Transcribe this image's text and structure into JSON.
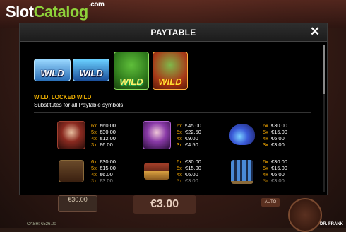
{
  "logo": {
    "part1": "Slot",
    "part2": "Catalog",
    "suffix": ".com"
  },
  "modal": {
    "title": "PAYTABLE",
    "close_glyph": "✕"
  },
  "wild_symbols": [
    {
      "label": "WILD",
      "icon": "wild-ice-icon"
    },
    {
      "label": "WILD",
      "icon": "wild-lightning-icon"
    },
    {
      "label": "WILD",
      "icon": "frankenstein-wild-icon"
    },
    {
      "label": "WILD",
      "icon": "locked-frankenstein-wild-icon"
    }
  ],
  "wild_info": {
    "heading": "WILD, LOCKED WILD",
    "description": "Substitutes for all Paytable symbols."
  },
  "paytable": [
    {
      "icon": "doctor-icon",
      "pays": [
        [
          "6x",
          "€60.00"
        ],
        [
          "5x",
          "€30.00"
        ],
        [
          "4x",
          "€12.00"
        ],
        [
          "3x",
          "€6.00"
        ]
      ]
    },
    {
      "icon": "bride-icon",
      "pays": [
        [
          "6x",
          "€45.00"
        ],
        [
          "5x",
          "€22.50"
        ],
        [
          "4x",
          "€9.00"
        ],
        [
          "3x",
          "€4.50"
        ]
      ]
    },
    {
      "icon": "potion-flask-icon",
      "pays": [
        [
          "6x",
          "€30.00"
        ],
        [
          "5x",
          "€15.00"
        ],
        [
          "4x",
          "€6.00"
        ],
        [
          "3x",
          "€3.00"
        ]
      ]
    },
    {
      "icon": "machine-box-icon",
      "pays": [
        [
          "6x",
          "€30.00"
        ],
        [
          "5x",
          "€15.00"
        ],
        [
          "4x",
          "€6.00"
        ],
        [
          "3x",
          "€3.00"
        ]
      ]
    },
    {
      "icon": "books-icon",
      "pays": [
        [
          "6x",
          "€30.00"
        ],
        [
          "5x",
          "€15.00"
        ],
        [
          "4x",
          "€6.00"
        ],
        [
          "3x",
          "€3.00"
        ]
      ]
    },
    {
      "icon": "test-tubes-icon",
      "pays": [
        [
          "6x",
          "€30.00"
        ],
        [
          "5x",
          "€15.00"
        ],
        [
          "4x",
          "€6.00"
        ],
        [
          "3x",
          "€3.00"
        ]
      ]
    }
  ],
  "footer": {
    "bet": "€30.00",
    "win": "€3.00",
    "auto_label": "AUTO",
    "cash": "CASH: €526.00",
    "brand": "DR. FRANK"
  },
  "colors": {
    "accent": "#f5a800",
    "modal_bg": "#000000"
  }
}
